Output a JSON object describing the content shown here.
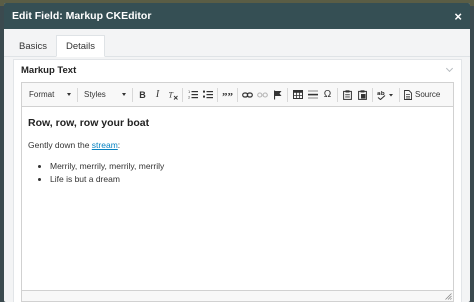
{
  "dialog": {
    "title": "Edit Field: Markup CKEditor"
  },
  "tabs": [
    {
      "label": "Basics"
    },
    {
      "label": "Details"
    }
  ],
  "field": {
    "label": "Markup Text"
  },
  "toolbar": {
    "format_label": "Format",
    "styles_label": "Styles",
    "bold_label": "B",
    "italic_label": "I",
    "blockquote_label": "””",
    "omega_label": "Ω",
    "source_label": "Source"
  },
  "content": {
    "heading": "Row, row, row your boat",
    "paragraph_text": "Gently down the ",
    "link_text": "stream",
    "paragraph_end": ":",
    "list_items": [
      "Merrily, merrily, merrily, merrily",
      "Life is but a dream"
    ]
  },
  "colors": {
    "titlebar": "#354f54",
    "link": "#0782c1"
  }
}
